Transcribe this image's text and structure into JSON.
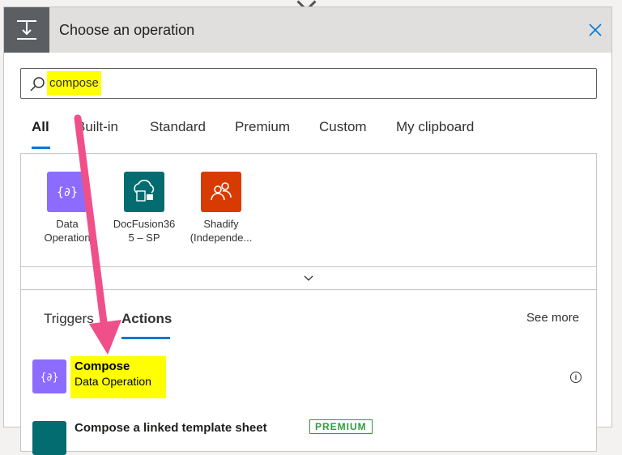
{
  "header": {
    "title": "Choose an operation"
  },
  "search": {
    "value": "compose"
  },
  "tabs": [
    {
      "label": "All"
    },
    {
      "label": "Built-in"
    },
    {
      "label": "Standard"
    },
    {
      "label": "Premium"
    },
    {
      "label": "Custom"
    },
    {
      "label": "My clipboard"
    }
  ],
  "connectors": [
    {
      "line1": "Data",
      "line2": "Operation",
      "color": "#8c6cff",
      "icon": "data-operation-icon"
    },
    {
      "line1": "DocFusion36",
      "line2": "5 – SP",
      "color": "#036c70",
      "icon": "cloud-document-icon"
    },
    {
      "line1": "Shadify",
      "line2": "(Independe...",
      "color": "#d83b01",
      "icon": "people-icon"
    }
  ],
  "subtabs": [
    {
      "label": "Triggers"
    },
    {
      "label": "Actions"
    }
  ],
  "see_more": "See more",
  "action": {
    "title": "Compose",
    "subtitle": "Data Operation"
  },
  "next_action": {
    "title": "Compose a linked template sheet",
    "badge": "PREMIUM"
  },
  "colors": {
    "accent": "#0078d4",
    "highlight": "#ffff00",
    "annotation_arrow": "#f0508a"
  }
}
